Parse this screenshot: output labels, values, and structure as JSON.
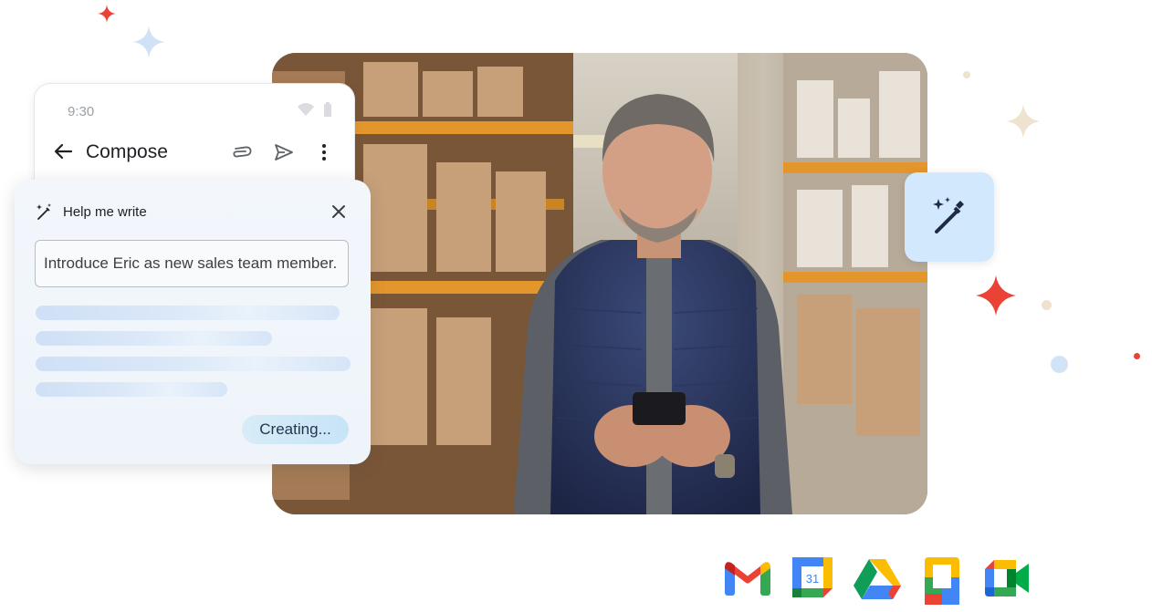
{
  "phone": {
    "time": "9:30",
    "compose_title": "Compose"
  },
  "help_me_write": {
    "title": "Help me write",
    "prompt_value": "Introduce Eric as new sales team member.",
    "creating_label": "Creating..."
  },
  "apps": {
    "calendar_day": "31",
    "icons": [
      "gmail-icon",
      "calendar-icon",
      "drive-icon",
      "docs-icon",
      "meet-icon"
    ]
  },
  "colors": {
    "accent_blue": "#d2e8fc",
    "sparkle_red": "#ea4335"
  }
}
